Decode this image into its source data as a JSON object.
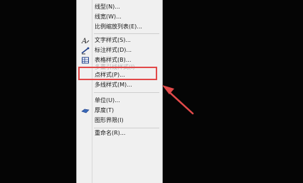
{
  "menu": {
    "items": [
      {
        "label": "线型(N)...",
        "icon": "",
        "disabled": false
      },
      {
        "label": "线宽(W)...",
        "icon": "",
        "disabled": false
      },
      {
        "label": "比例缩放列表(E)...",
        "icon": "",
        "disabled": false
      },
      {
        "label": "文字样式(S)...",
        "icon": "text-style-icon",
        "disabled": false
      },
      {
        "label": "标注样式(D)...",
        "icon": "dimension-style-icon",
        "disabled": false
      },
      {
        "label": "表格样式(B)...",
        "icon": "table-style-icon",
        "disabled": false
      },
      {
        "label": "多重引线样式(I)",
        "icon": "",
        "disabled": true
      },
      {
        "label": "点样式(P)...",
        "icon": "",
        "disabled": false
      },
      {
        "label": "多线样式(M)...",
        "icon": "",
        "disabled": false
      },
      {
        "label": "单位(U)...",
        "icon": "",
        "disabled": false
      },
      {
        "label": "厚度(T)",
        "icon": "thickness-icon",
        "disabled": false
      },
      {
        "label": "图形界限(I)",
        "icon": "",
        "disabled": false
      },
      {
        "label": "重命名(R)...",
        "icon": "",
        "disabled": false
      }
    ]
  },
  "annotation": {
    "highlight_color": "#e24a4a",
    "highlighted_item": "点样式(P)..."
  }
}
